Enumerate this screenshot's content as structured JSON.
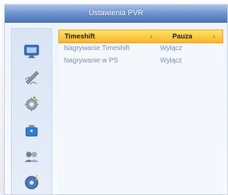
{
  "window": {
    "title": "Ustawienia PVR"
  },
  "sidebar": {
    "icons": [
      {
        "name": "tv-icon"
      },
      {
        "name": "satellite-dish-icon"
      },
      {
        "name": "settings-icon"
      },
      {
        "name": "toolbox-icon"
      },
      {
        "name": "group-icon"
      },
      {
        "name": "pvr-icon"
      }
    ]
  },
  "settings": {
    "items": [
      {
        "label": "Timeshift",
        "value": "Pauza",
        "selected": true
      },
      {
        "label": "Nagrywanie Timeshift",
        "value": "Wyłącz",
        "selected": false
      },
      {
        "label": "Nagrywanie w PS",
        "value": "Wyłącz",
        "selected": false
      }
    ],
    "left_arrow": "‹",
    "right_arrow": "›"
  },
  "colors": {
    "title_bar": "#5d82c2",
    "selected_row": "#f7b52c",
    "text_inactive": "#7c8fab",
    "text_active": "#1c1c1c"
  }
}
